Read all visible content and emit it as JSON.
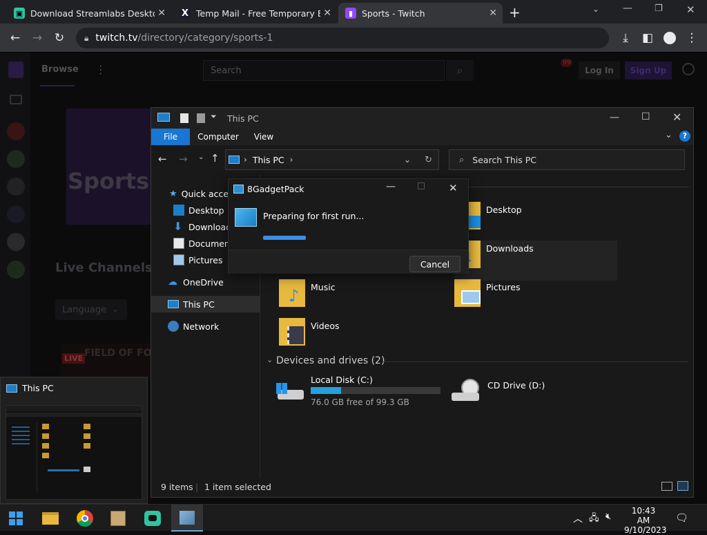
{
  "browser": {
    "tabs": [
      {
        "title": "Download Streamlabs Desktop L",
        "favicon": "streamlabs-icon",
        "active": false
      },
      {
        "title": "Temp Mail - Free Temporary Ema",
        "favicon": "x-logo-icon",
        "active": false
      },
      {
        "title": "Sports - Twitch",
        "favicon": "twitch-icon",
        "active": true
      }
    ],
    "new_tab": "+",
    "url_host": "twitch.tv",
    "url_path": "/directory/category/sports-1"
  },
  "twitch": {
    "browse": "Browse",
    "search_placeholder": "Search",
    "notif_count": "99",
    "login": "Log In",
    "signup": "Sign Up",
    "category": "Sports",
    "live_channels": "Live Channels",
    "language": "Language",
    "live_badge": "LIVE",
    "stream_banner": "FIELD OF FORTU"
  },
  "explorer": {
    "title": "This PC",
    "ribbon_tabs": [
      "File",
      "Computer",
      "View"
    ],
    "address_location": "This PC",
    "search_placeholder": "Search This PC",
    "nav": {
      "quick_access": "Quick acces",
      "desktop": "Desktop",
      "downloads": "Download:",
      "documents": "Document",
      "pictures": "Pictures",
      "onedrive": "OneDrive",
      "this_pc": "This PC",
      "network": "Network"
    },
    "folders": {
      "desktop": "Desktop",
      "downloads": "Downloads",
      "music": "Music",
      "pictures": "Pictures",
      "videos": "Videos"
    },
    "devices_header": "Devices and drives (2)",
    "drives": [
      {
        "name": "Local Disk (C:)",
        "free": "76.0 GB free of 99.3 GB",
        "used_fraction": 0.235
      },
      {
        "name": "CD Drive (D:)"
      }
    ],
    "status_items": "9 items",
    "status_selected": "1 item selected"
  },
  "dialog": {
    "title": "8GadgetPack",
    "message": "Preparing for first run...",
    "progress_fraction": 0.22,
    "cancel": "Cancel"
  },
  "thumbnail": {
    "title": "This PC"
  },
  "taskbar": {
    "time": "10:43 AM",
    "date": "9/10/2023"
  },
  "colors": {
    "accent_blue": "#0078d4",
    "twitch_purple": "#9147ff",
    "drive_bar": "#26a0da"
  }
}
